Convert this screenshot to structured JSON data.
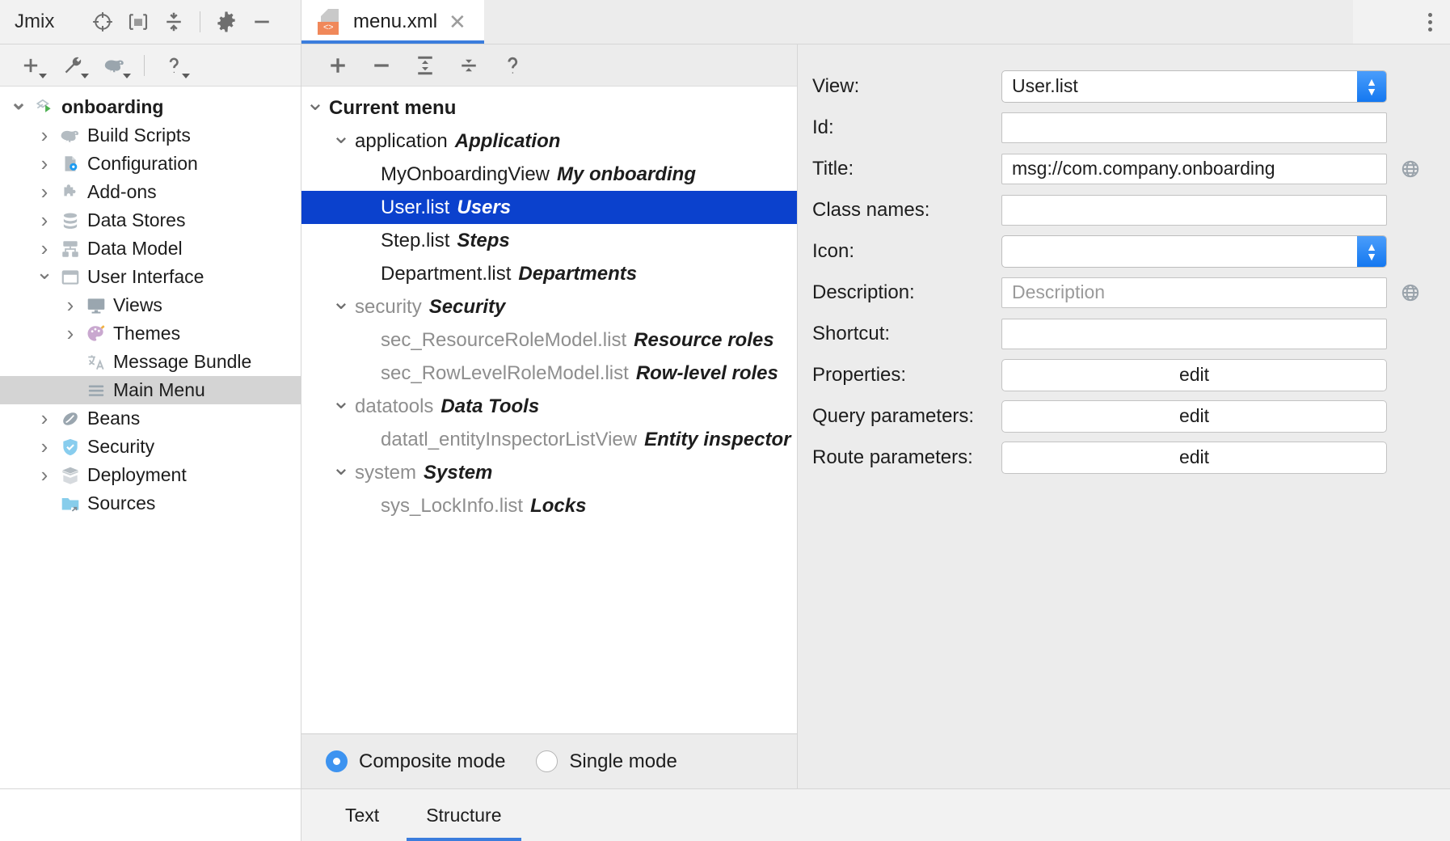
{
  "topbar": {
    "app_label": "Jmix",
    "icons": [
      "target-icon",
      "folder-bracket-icon",
      "collapse-all-icon",
      "gear-icon",
      "minimize-icon"
    ],
    "kebab_name": "more-options-icon",
    "tab": {
      "title": "menu.xml",
      "badge": "<>",
      "close": "✕"
    }
  },
  "left_toolbar": {
    "icons": [
      "add-icon",
      "wrench-icon",
      "gradle-elephant-icon",
      "help-icon"
    ]
  },
  "project_tree": [
    {
      "label": "onboarding",
      "indent": 0,
      "arrow": "open",
      "icon": "jmix-project-icon",
      "bold": true,
      "selected": false
    },
    {
      "label": "Build Scripts",
      "indent": 1,
      "arrow": "closed",
      "icon": "gradle-elephant-icon",
      "bold": false,
      "selected": false
    },
    {
      "label": "Configuration",
      "indent": 1,
      "arrow": "closed",
      "icon": "configuration-icon",
      "bold": false,
      "selected": false
    },
    {
      "label": "Add-ons",
      "indent": 1,
      "arrow": "closed",
      "icon": "addons-puzzle-icon",
      "bold": false,
      "selected": false
    },
    {
      "label": "Data Stores",
      "indent": 1,
      "arrow": "closed",
      "icon": "database-icon",
      "bold": false,
      "selected": false
    },
    {
      "label": "Data Model",
      "indent": 1,
      "arrow": "closed",
      "icon": "data-model-icon",
      "bold": false,
      "selected": false
    },
    {
      "label": "User Interface",
      "indent": 1,
      "arrow": "open",
      "icon": "window-icon",
      "bold": false,
      "selected": false
    },
    {
      "label": "Views",
      "indent": 2,
      "arrow": "closed",
      "icon": "monitor-icon",
      "bold": false,
      "selected": false
    },
    {
      "label": "Themes",
      "indent": 2,
      "arrow": "closed",
      "icon": "palette-icon",
      "bold": false,
      "selected": false
    },
    {
      "label": "Message Bundle",
      "indent": 2,
      "arrow": "blank",
      "icon": "translate-icon",
      "bold": false,
      "selected": false
    },
    {
      "label": "Main Menu",
      "indent": 2,
      "arrow": "blank",
      "icon": "hamburger-menu-icon",
      "bold": false,
      "selected": true
    },
    {
      "label": "Beans",
      "indent": 1,
      "arrow": "closed",
      "icon": "bean-icon",
      "bold": false,
      "selected": false
    },
    {
      "label": "Security",
      "indent": 1,
      "arrow": "closed",
      "icon": "shield-icon",
      "bold": false,
      "selected": false
    },
    {
      "label": "Deployment",
      "indent": 1,
      "arrow": "closed",
      "icon": "package-icon",
      "bold": false,
      "selected": false
    },
    {
      "label": "Sources",
      "indent": 1,
      "arrow": "blank",
      "icon": "folder-link-icon",
      "bold": false,
      "selected": false
    }
  ],
  "center_toolbar": {
    "icons": [
      "add-icon",
      "remove-icon",
      "expand-all-icon",
      "collapse-all-icon",
      "help-icon"
    ]
  },
  "menu_tree": [
    {
      "id": "Current menu",
      "caption": "",
      "indent": 0,
      "arrow": "open",
      "bold": true,
      "grey": false,
      "selected": false
    },
    {
      "id": "application",
      "caption": "Application",
      "indent": 1,
      "arrow": "open",
      "bold": false,
      "grey": false,
      "selected": false
    },
    {
      "id": "MyOnboardingView",
      "caption": "My onboarding",
      "indent": 2,
      "arrow": "blank",
      "bold": false,
      "grey": false,
      "selected": false
    },
    {
      "id": "User.list",
      "caption": "Users",
      "indent": 2,
      "arrow": "blank",
      "bold": false,
      "grey": false,
      "selected": true
    },
    {
      "id": "Step.list",
      "caption": "Steps",
      "indent": 2,
      "arrow": "blank",
      "bold": false,
      "grey": false,
      "selected": false
    },
    {
      "id": "Department.list",
      "caption": "Departments",
      "indent": 2,
      "arrow": "blank",
      "bold": false,
      "grey": false,
      "selected": false
    },
    {
      "id": "security",
      "caption": "Security",
      "indent": 1,
      "arrow": "open",
      "bold": false,
      "grey": true,
      "selected": false
    },
    {
      "id": "sec_ResourceRoleModel.list",
      "caption": "Resource roles",
      "indent": 2,
      "arrow": "blank",
      "bold": false,
      "grey": true,
      "selected": false
    },
    {
      "id": "sec_RowLevelRoleModel.list",
      "caption": "Row-level roles",
      "indent": 2,
      "arrow": "blank",
      "bold": false,
      "grey": true,
      "selected": false
    },
    {
      "id": "datatools",
      "caption": "Data Tools",
      "indent": 1,
      "arrow": "open",
      "bold": false,
      "grey": true,
      "selected": false
    },
    {
      "id": "datatl_entityInspectorListView",
      "caption": "Entity inspector",
      "indent": 2,
      "arrow": "blank",
      "bold": false,
      "grey": true,
      "selected": false
    },
    {
      "id": "system",
      "caption": "System",
      "indent": 1,
      "arrow": "open",
      "bold": false,
      "grey": true,
      "selected": false
    },
    {
      "id": "sys_LockInfo.list",
      "caption": "Locks",
      "indent": 2,
      "arrow": "blank",
      "bold": false,
      "grey": true,
      "selected": false
    }
  ],
  "mode_bar": {
    "composite_label": "Composite mode",
    "single_label": "Single mode",
    "selected": "Composite mode"
  },
  "properties": {
    "view": {
      "label": "View:",
      "value": "User.list",
      "type": "combo"
    },
    "id": {
      "label": "Id:",
      "value": "",
      "type": "text"
    },
    "title": {
      "label": "Title:",
      "value": "msg://com.company.onboarding",
      "type": "text",
      "globe": true
    },
    "class_names": {
      "label": "Class names:",
      "value": "",
      "type": "text"
    },
    "icon": {
      "label": "Icon:",
      "value": "",
      "type": "combo"
    },
    "description": {
      "label": "Description:",
      "value": "",
      "placeholder": "Description",
      "type": "text",
      "globe": true
    },
    "shortcut": {
      "label": "Shortcut:",
      "value": "",
      "type": "text"
    },
    "props": {
      "label": "Properties:",
      "value": "edit",
      "type": "button"
    },
    "query_params": {
      "label": "Query parameters:",
      "value": "edit",
      "type": "button"
    },
    "route_params": {
      "label": "Route parameters:",
      "value": "edit",
      "type": "button"
    }
  },
  "bottom_tabs": [
    {
      "label": "Text",
      "active": false
    },
    {
      "label": "Structure",
      "active": true
    }
  ],
  "colors": {
    "selection_blue": "#0b41cd",
    "accent_blue": "#3b7ddd",
    "tree_selected_grey": "#d4d4d4",
    "panel_grey": "#ececec",
    "xml_badge_orange": "#f0885a"
  }
}
